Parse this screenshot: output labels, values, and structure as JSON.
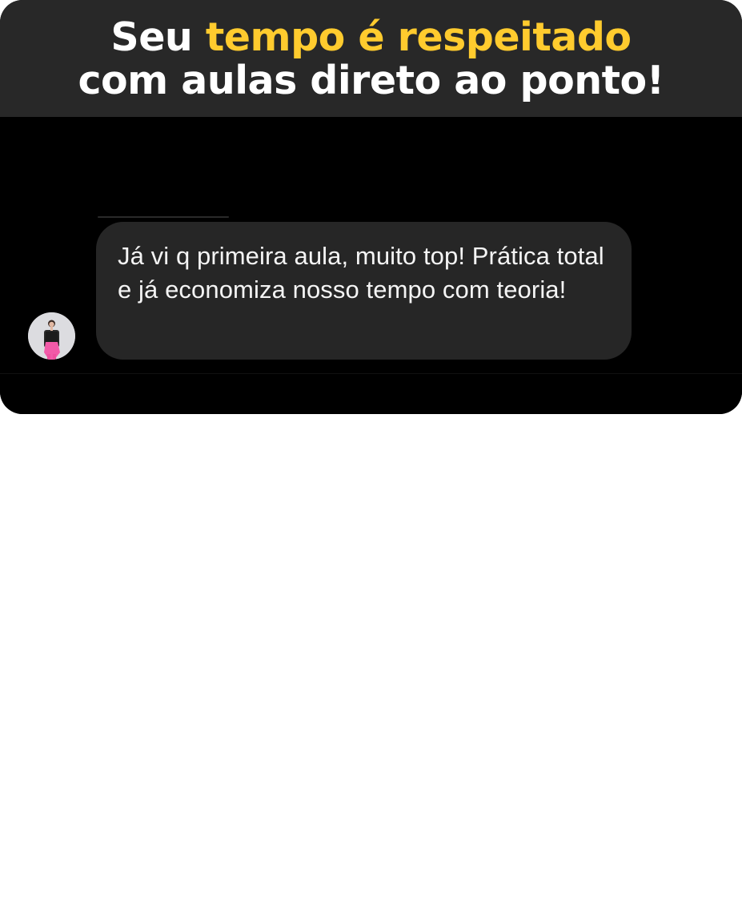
{
  "header": {
    "line1_prefix": "Seu ",
    "line1_highlight": "tempo é respeitado",
    "line2": "com aulas direto ao ponto!",
    "accent_color": "#ffcb2e"
  },
  "chat": {
    "message": "Já vi q primeira aula, muito top! Prática total e já economiza nosso tempo com teoria!",
    "avatar_icon": "user-avatar-photo"
  }
}
